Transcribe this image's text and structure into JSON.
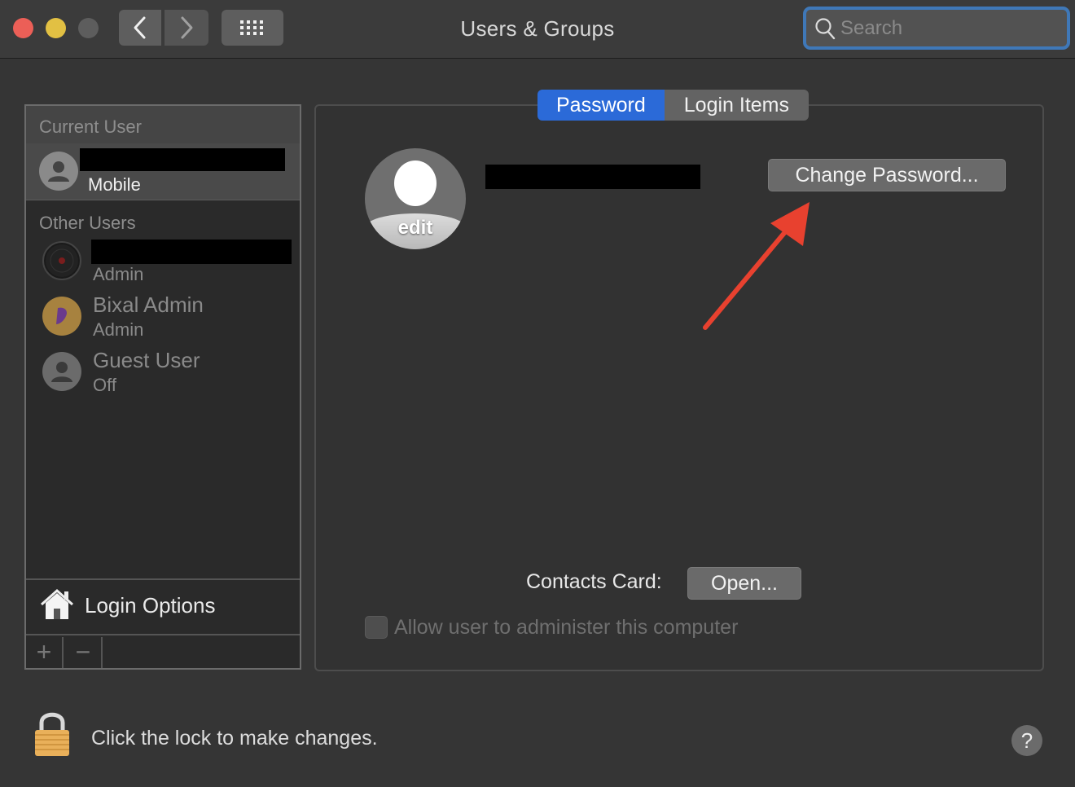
{
  "window": {
    "title": "Users & Groups"
  },
  "toolbar": {
    "back_icon": "chevron-left-icon",
    "forward_icon": "chevron-right-icon",
    "grid_icon": "show-all-grid-icon"
  },
  "search": {
    "placeholder": "Search",
    "value": ""
  },
  "sidebar": {
    "current_user_header": "Current User",
    "current_user": {
      "role": "Mobile"
    },
    "other_users_header": "Other Users",
    "other_users": [
      {
        "name": "",
        "role": "Admin"
      },
      {
        "name": "Bixal Admin",
        "role": "Admin"
      },
      {
        "name": "Guest User",
        "role": "Off"
      }
    ],
    "login_options_label": "Login Options",
    "add_label": "+",
    "remove_label": "−"
  },
  "tabs": [
    {
      "label": "Password",
      "active": true
    },
    {
      "label": "Login Items",
      "active": false
    }
  ],
  "main": {
    "avatar_edit_label": "edit",
    "change_password_label": "Change Password...",
    "contacts_card_label": "Contacts Card:",
    "open_button_label": "Open...",
    "allow_admin_label": "Allow user to administer this computer",
    "allow_admin_checked": false
  },
  "footer": {
    "lock_text": "Click the lock to make changes.",
    "help_label": "?"
  },
  "colors": {
    "accent": "#2b6ad8",
    "annotation_arrow": "#e8412f",
    "close": "#ec5f57",
    "minimize": "#e2c043"
  }
}
